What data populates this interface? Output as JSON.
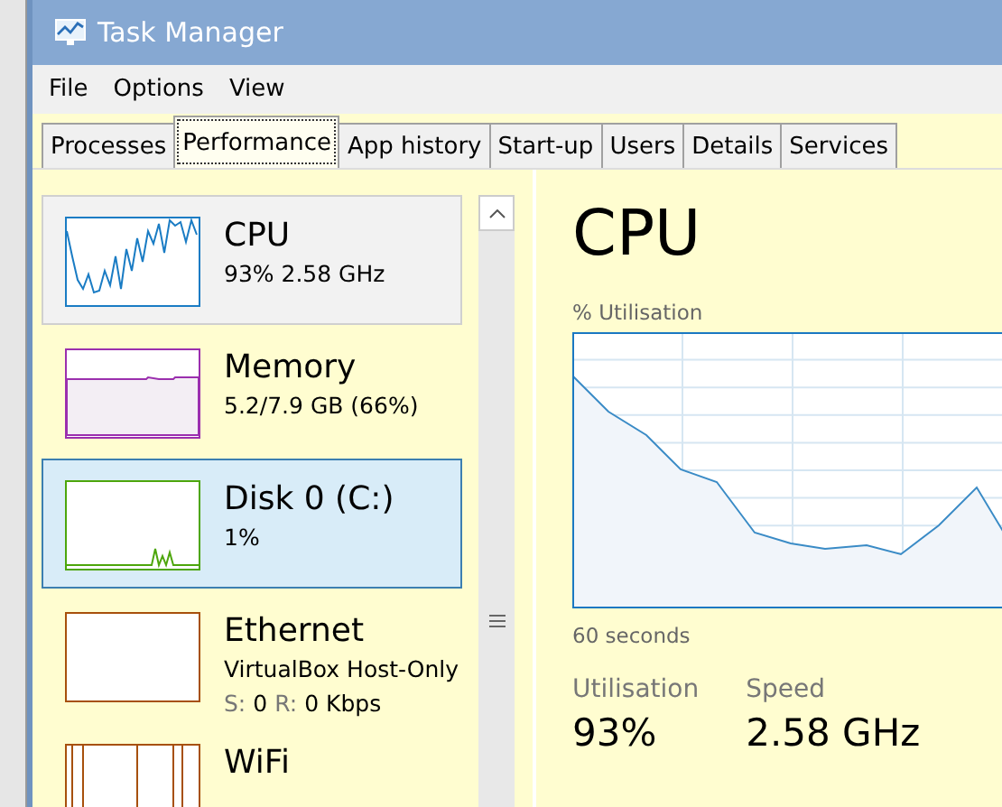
{
  "window": {
    "title": "Task Manager"
  },
  "menu": [
    "File",
    "Options",
    "View"
  ],
  "tabs": [
    {
      "label": "Processes",
      "selected": false
    },
    {
      "label": "Performance",
      "selected": true
    },
    {
      "label": "App history",
      "selected": false
    },
    {
      "label": "Start-up",
      "selected": false
    },
    {
      "label": "Users",
      "selected": false
    },
    {
      "label": "Details",
      "selected": false
    },
    {
      "label": "Services",
      "selected": false
    }
  ],
  "sidebar": {
    "items": [
      {
        "kind": "cpu",
        "name": "CPU",
        "lines": [
          "93%  2.58 GHz"
        ],
        "color": "#1a7cc4",
        "selected": false,
        "highlighted": true
      },
      {
        "kind": "memory",
        "name": "Memory",
        "lines": [
          "5.2/7.9 GB (66%)"
        ],
        "color": "#9b2fae",
        "selected": false,
        "highlighted": false
      },
      {
        "kind": "disk",
        "name": "Disk 0 (C:)",
        "lines": [
          "1%"
        ],
        "color": "#4da60c",
        "selected": true,
        "highlighted": false
      },
      {
        "kind": "ethernet",
        "name": "Ethernet",
        "lines": [
          "VirtualBox Host-Only"
        ],
        "rates": [
          {
            "label": "S:",
            "value": "0"
          },
          {
            "label": "R:",
            "value": "0 Kbps"
          }
        ],
        "color": "#a7500c",
        "selected": false,
        "highlighted": false
      },
      {
        "kind": "wifi",
        "name": "WiFi",
        "color": "#a7500c",
        "selected": false,
        "highlighted": false
      }
    ]
  },
  "detail": {
    "title": "CPU",
    "chart_label": "% Utilisation",
    "time_label": "60 seconds",
    "stats": [
      {
        "label": "Utilisation",
        "value": "93%"
      },
      {
        "label": "Speed",
        "value": "2.58 GHz"
      }
    ]
  }
}
